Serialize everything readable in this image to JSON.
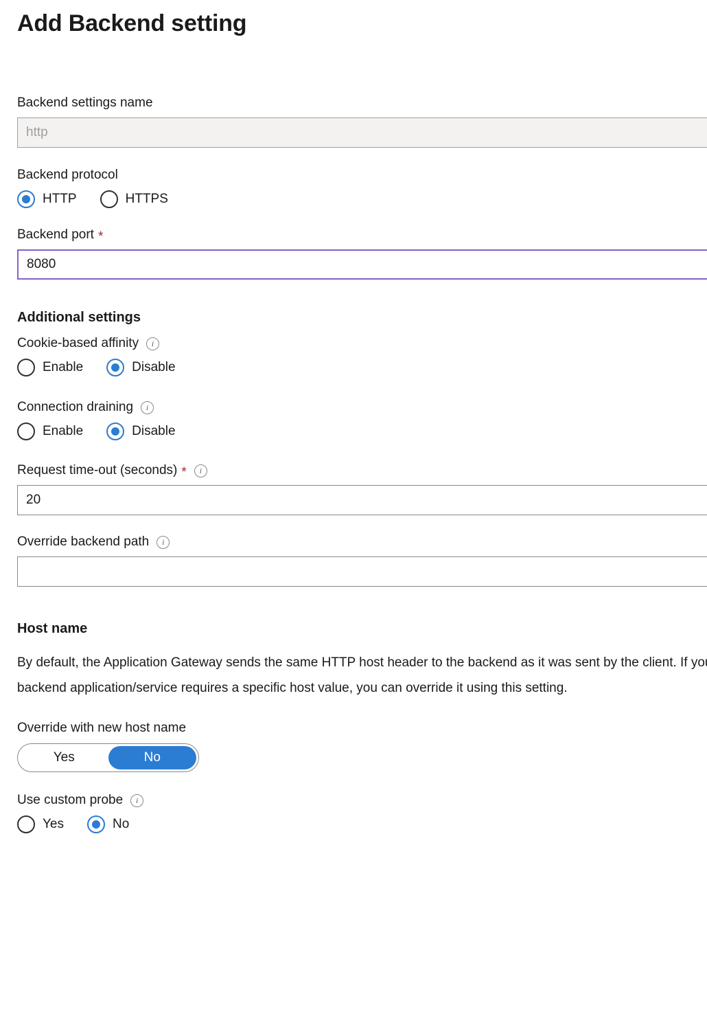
{
  "blade": {
    "title": "Add Backend setting"
  },
  "fields": {
    "backend_settings_name": {
      "label": "Backend settings name",
      "value": "",
      "placeholder": "http",
      "disabled": true
    },
    "backend_protocol": {
      "label": "Backend protocol",
      "options": [
        "HTTP",
        "HTTPS"
      ],
      "selected": "HTTP"
    },
    "backend_port": {
      "label": "Backend port",
      "required_marker": "*",
      "value": "8080",
      "placeholder": ""
    }
  },
  "additional_settings": {
    "heading": "Additional settings",
    "cookie_based_affinity": {
      "label": "Cookie-based affinity",
      "info_icon": "info-icon",
      "options": [
        "Enable",
        "Disable"
      ],
      "selected": "Disable"
    },
    "connection_draining": {
      "label": "Connection draining",
      "info_icon": "info-icon",
      "options": [
        "Enable",
        "Disable"
      ],
      "selected": "Disable"
    },
    "request_timeout": {
      "label": "Request time-out (seconds)",
      "required_marker": "*",
      "info_icon": "info-icon",
      "value": "20",
      "placeholder": ""
    },
    "override_backend_path": {
      "label": "Override backend path",
      "info_icon": "info-icon",
      "value": "",
      "placeholder": ""
    }
  },
  "host_name": {
    "heading": "Host name",
    "description": "By default, the Application Gateway sends the same HTTP host header to the backend as it was sent by the client. If your\nbackend application/service requires a specific host value, you can override it using this setting.",
    "override_with_new_host_name": {
      "label": "Override with new host name",
      "options": [
        "Yes",
        "No"
      ],
      "selected": "No"
    },
    "use_custom_probe": {
      "label": "Use custom probe",
      "info_icon": "info-icon",
      "options": [
        "Yes",
        "No"
      ],
      "selected": "No"
    }
  },
  "colors": {
    "accent_blue": "#2b7cd3",
    "focus_purple": "#8661c5",
    "required_red": "#a4262c",
    "disabled_bg": "#f3f2f1",
    "border_gray": "#8a8886",
    "text_primary": "#1b1a19"
  }
}
